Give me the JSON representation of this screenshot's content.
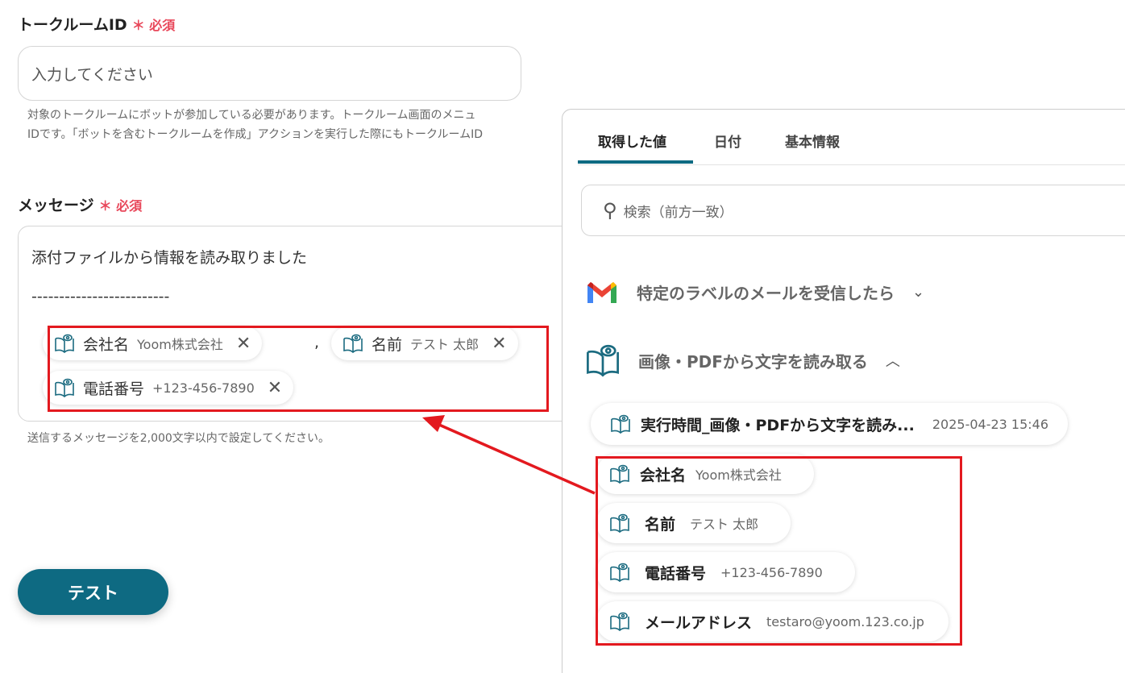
{
  "form": {
    "room_label": "トークルームID",
    "required": "＊ 必須",
    "room_placeholder": "入力してください",
    "room_help_1": "対象のトークルームにボットが参加している必要があります。トークルーム画面のメニュ",
    "room_help_2": "IDです。「ボットを含むトークルームを作成」アクションを実行した際にもトークルームID",
    "message_label": "メッセージ",
    "message_line1": "添付ファイルから情報を読み取りました",
    "message_line2": "-------------------------",
    "separator": ",",
    "chips": [
      {
        "key": "会社名",
        "value": "Yoom株式会社"
      },
      {
        "key": "名前",
        "value": "テスト 太郎"
      },
      {
        "key": "電話番号",
        "value": "+123-456-7890"
      }
    ],
    "message_help": "送信するメッセージを2,000文字以内で設定してください。",
    "test_button": "テスト"
  },
  "panel": {
    "tabs": [
      "取得した値",
      "日付",
      "基本情報"
    ],
    "search_placeholder": "検索（前方一致）",
    "sections": [
      {
        "title": "特定のラベルのメールを受信したら",
        "icon": "gmail-icon"
      },
      {
        "title": "画像・PDFから文字を読み取る",
        "icon": "ocr-book-icon"
      }
    ],
    "items": [
      {
        "key": "実行時間_画像・PDFから文字を読み...",
        "value": "2025-04-23 15:46"
      },
      {
        "key": "会社名",
        "value": "Yoom株式会社"
      },
      {
        "key": "名前",
        "value": "テスト 太郎"
      },
      {
        "key": "電話番号",
        "value": "+123-456-7890"
      },
      {
        "key": "メールアドレス",
        "value": "testaro@yoom.123.co.jp"
      }
    ]
  },
  "colors": {
    "accent": "#0e6a82",
    "required": "#e8475a",
    "annotation": "#e3191f"
  }
}
